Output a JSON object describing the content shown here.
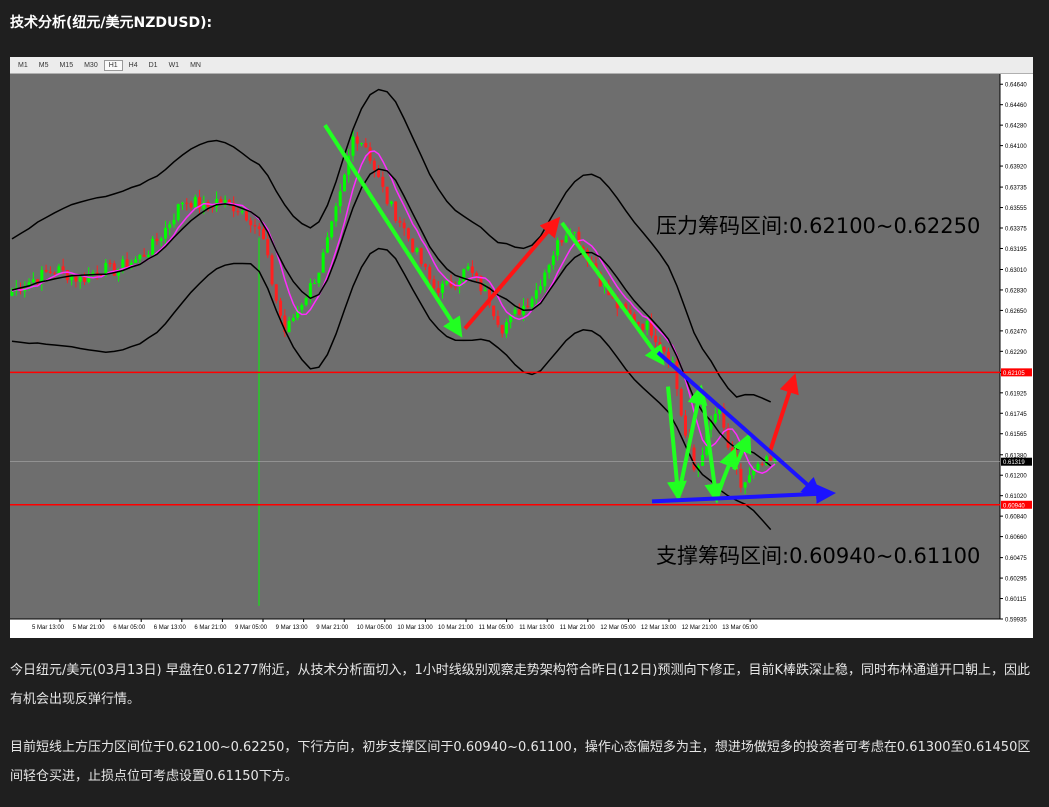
{
  "heading": "技术分析(纽元/美元NZDUSD):",
  "timeframes": [
    "M1",
    "M5",
    "M15",
    "M30",
    "H1",
    "H4",
    "D1",
    "W1",
    "MN"
  ],
  "active_timeframe": "H1",
  "chart_data": {
    "type": "candlestick",
    "symbol": "NZDUSD",
    "timeframe": "H1",
    "y_ticks": [
      "0.64640",
      "0.64460",
      "0.64280",
      "0.64100",
      "0.63920",
      "0.63735",
      "0.63555",
      "0.63375",
      "0.63195",
      "0.63010",
      "0.62830",
      "0.62650",
      "0.62470",
      "0.62290",
      "0.62105",
      "0.61925",
      "0.61745",
      "0.61565",
      "0.61380",
      "0.61200",
      "0.61020",
      "0.60840",
      "0.60660",
      "0.60475",
      "0.60295",
      "0.60115",
      "0.59935"
    ],
    "ylim": [
      0.59935,
      0.6473
    ],
    "x_ticks": [
      "5 Mar 13:00",
      "5 Mar 21:00",
      "6 Mar 05:00",
      "6 Mar 13:00",
      "6 Mar 21:00",
      "9 Mar 05:00",
      "9 Mar 13:00",
      "9 Mar 21:00",
      "10 Mar 05:00",
      "10 Mar 13:00",
      "10 Mar 21:00",
      "11 Mar 05:00",
      "11 Mar 13:00",
      "11 Mar 21:00",
      "12 Mar 05:00",
      "12 Mar 13:00",
      "12 Mar 21:00",
      "13 Mar 05:00"
    ],
    "current_price_label": "0.61319",
    "resistance_line_label": "0.62105",
    "support_line_label": "0.60940",
    "resistance_zone_text": "压力筹码区间:0.62100~0.62250",
    "support_zone_text": "支撑筹码区间:0.60940~0.61100",
    "close_path": [
      0.6282,
      0.6288,
      0.6293,
      0.6298,
      0.6301,
      0.6296,
      0.6292,
      0.6298,
      0.6302,
      0.63,
      0.6306,
      0.631,
      0.6318,
      0.633,
      0.6345,
      0.6362,
      0.636,
      0.6355,
      0.6362,
      0.6358,
      0.6355,
      0.6345,
      0.633,
      0.6282,
      0.6245,
      0.6265,
      0.6282,
      0.6302,
      0.6335,
      0.6372,
      0.642,
      0.6412,
      0.6385,
      0.636,
      0.6345,
      0.6325,
      0.6305,
      0.6285,
      0.6285,
      0.6292,
      0.6302,
      0.6288,
      0.6272,
      0.625,
      0.626,
      0.627,
      0.6282,
      0.6305,
      0.6325,
      0.634,
      0.6322,
      0.6305,
      0.6285,
      0.627,
      0.6262,
      0.6255,
      0.625,
      0.6235,
      0.622,
      0.616,
      0.612,
      0.6155,
      0.618,
      0.614,
      0.611,
      0.612,
      0.613,
      0.6132
    ],
    "colors": {
      "background": "#6e6e6e",
      "up": "#00ff00",
      "down": "#ff2020",
      "bands": "#000000",
      "ma": "#ff2cff",
      "hline": "#ff0000",
      "arrow_green": "#21ff21",
      "arrow_red": "#ff1414",
      "arrow_blue": "#1b12ff"
    }
  },
  "paragraphs": [
    "今日纽元/美元(03月13日) 早盘在0.61277附近，从技术分析面切入，1小时线级别观察走势架构符合昨日(12日)预测向下修正，目前K棒跌深止稳，同时布林通道开口朝上，因此有机会出现反弹行情。",
    "目前短线上方压力区间位于0.62100~0.62250，下行方向，初步支撑区间于0.60940~0.61100，操作心态偏短多为主，想进场做短多的投资者可考虑在0.61300至0.61450区间轻仓买进，止损点位可考虑设置0.61150下方。"
  ]
}
